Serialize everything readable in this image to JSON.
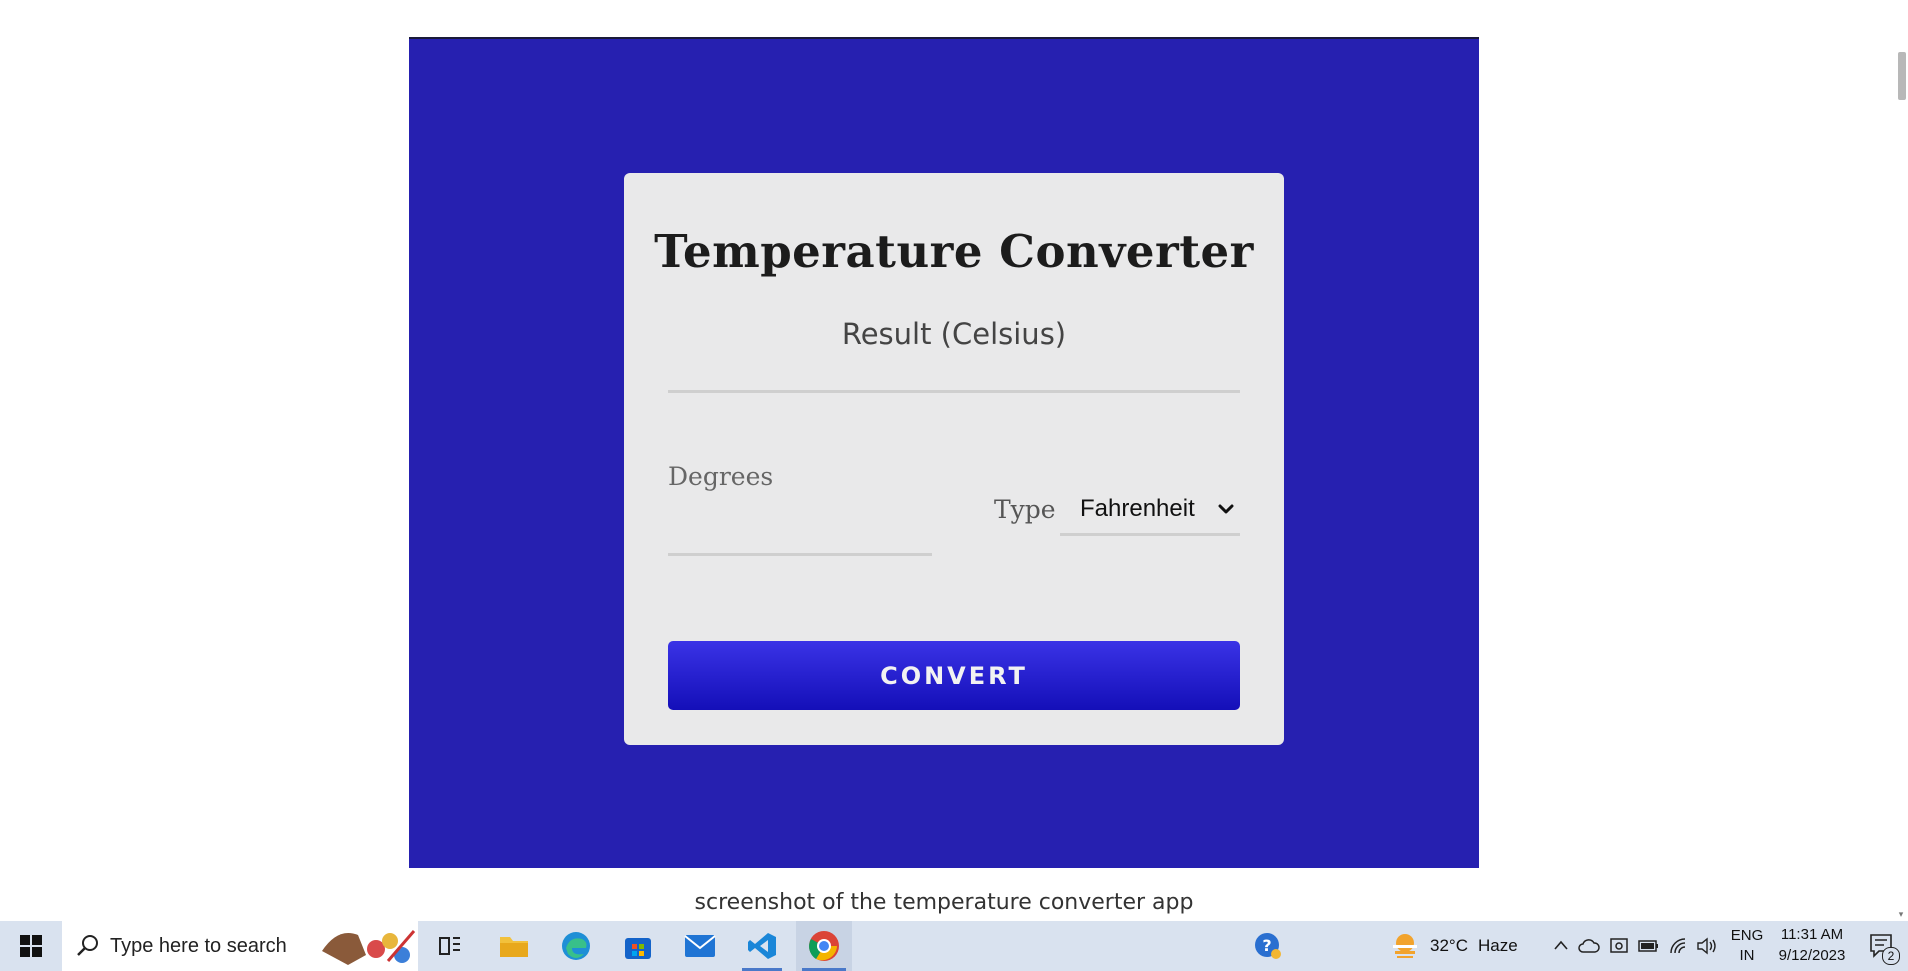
{
  "app": {
    "title": "Temperature Converter",
    "result_label": "Result (Celsius)",
    "degrees_label": "Degrees",
    "degrees_value": "",
    "type_label": "Type",
    "type_selected": "Fahrenheit",
    "convert_label": "CONVERT"
  },
  "caption": "screenshot of the temperature converter app",
  "taskbar": {
    "search_placeholder": "Type here to search",
    "weather_temp": "32°C",
    "weather_desc": "Haze",
    "lang_top": "ENG",
    "lang_bottom": "IN",
    "time": "11:31 AM",
    "date": "9/12/2023",
    "notification_count": "2",
    "icons": [
      "windows-start",
      "search",
      "task-view",
      "file-explorer",
      "edge",
      "store",
      "mail",
      "vscode",
      "chrome",
      "help",
      "weather",
      "chevron-up",
      "onedrive",
      "security",
      "battery",
      "wifi",
      "volume",
      "notifications"
    ]
  },
  "colors": {
    "background_blue": "#2620b0",
    "card": "#e9e9ea",
    "button_gradient_top": "#3a33e6",
    "button_gradient_bottom": "#140fb8",
    "taskbar": "#d9e2ef"
  }
}
